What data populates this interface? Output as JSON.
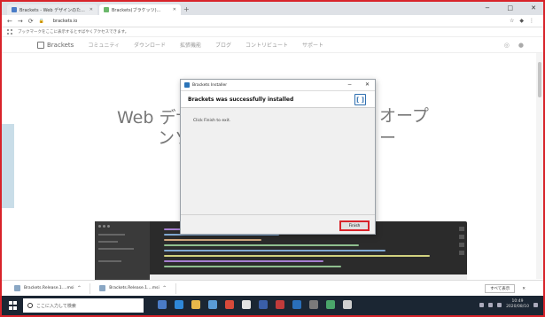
{
  "browser": {
    "tabs": [
      {
        "label": "Brackets - Web デザインのた..."
      },
      {
        "label": "Brackets(ブラケッツ)..."
      }
    ],
    "url": "brackets.io",
    "bookmarks_hint": "ブックマークをここに表示するとすばやくアクセスできます。"
  },
  "site": {
    "logo_text": "Brackets",
    "nav": [
      "コミュニティ",
      "ダウンロード",
      "拡張機能",
      "ブログ",
      "コントリビュート",
      "サポート"
    ],
    "hero": {
      "line1_left": "Web デザ",
      "line1_right": "オープ",
      "line2_left": "ンソ",
      "line2_right": "ー"
    }
  },
  "dialog": {
    "window_title": "Brackets Installer",
    "heading": "Brackets was successfully installed",
    "body": "Click Finish to exit.",
    "finish_label": "Finish",
    "logo_glyph": "[ ]"
  },
  "downloads": {
    "items": [
      "Brackets.Release.1....msi",
      "Brackets.Release.1....msi"
    ],
    "show_all": "すべて表示"
  },
  "taskbar": {
    "search_placeholder": "ここに入力して検索",
    "time": "10:49",
    "date": "2020/08/10"
  },
  "colors": {
    "highlight": "#d8232a",
    "taskbar": "#1b2633",
    "editor_bg": "#2b2b2b"
  }
}
